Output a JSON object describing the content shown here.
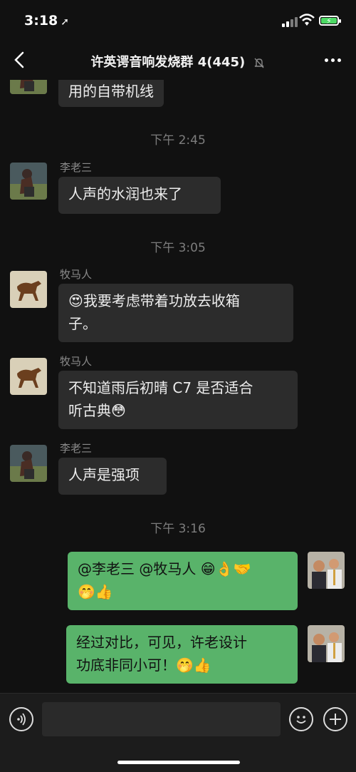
{
  "status": {
    "time": "3:18",
    "location_arrow": "➚",
    "battery_level": 1.0
  },
  "header": {
    "title": "许英谔音响发烧群 4(445)",
    "mute_icon": "bell-slash-icon"
  },
  "messages": [
    {
      "type": "text",
      "from": "other",
      "text": "用的自带机线"
    },
    {
      "type": "time",
      "text": "下午 2:45"
    },
    {
      "type": "text",
      "from": "other",
      "sender": "李老三",
      "text": "人声的水润也来了"
    },
    {
      "type": "time",
      "text": "下午 3:05"
    },
    {
      "type": "text",
      "from": "other",
      "sender": "牧马人",
      "emoji_lead": "😍",
      "line1": "我要考虑带着功放去收箱",
      "line2": "子。"
    },
    {
      "type": "text",
      "from": "other",
      "sender": "牧马人",
      "line1": "不知道雨后初晴 C7 是否适合",
      "line2": "听古典",
      "emoji_tail": "😳"
    },
    {
      "type": "text",
      "from": "other",
      "sender": "李老三",
      "text": "人声是强项"
    },
    {
      "type": "time",
      "text": "下午 3:16"
    },
    {
      "type": "text",
      "from": "me",
      "line1": "@李老三 @牧马人 ",
      "emoji1": "😁👌🤝",
      "emoji2": "🤭👍"
    },
    {
      "type": "text",
      "from": "me",
      "line1": "经过对比，可见，许老设计",
      "line2": "功底非同小可！",
      "emoji_tail": "🤭👍"
    }
  ],
  "colors": {
    "bubble_other": "#2c2c2c",
    "bubble_me": "#59b36a",
    "background": "#111111"
  }
}
